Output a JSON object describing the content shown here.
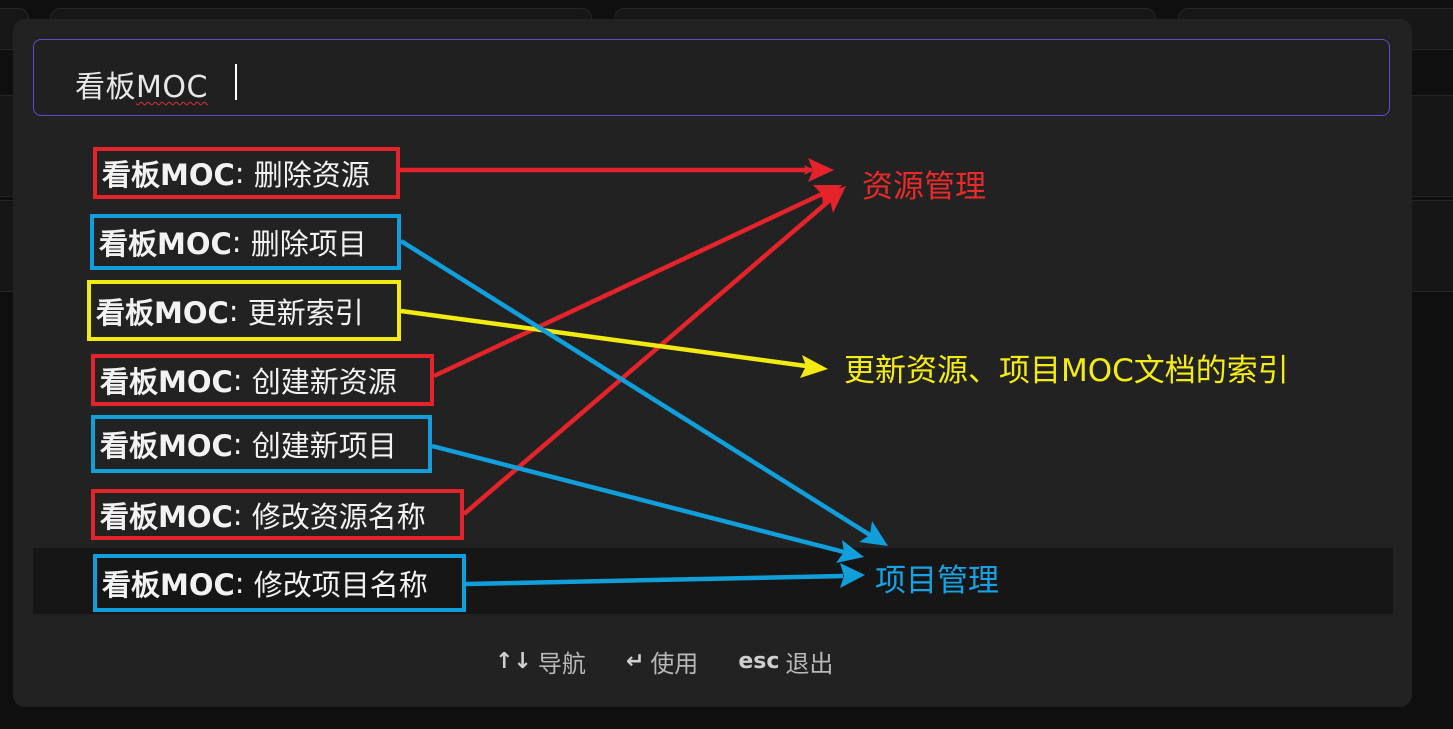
{
  "search": {
    "query_prefix": "看板",
    "query_suffix": "MOC"
  },
  "commands": [
    {
      "prefix": "看板MOC",
      "sep": ":",
      "action": "删除资源",
      "group": "资源管理"
    },
    {
      "prefix": "看板MOC",
      "sep": ":",
      "action": "删除项目",
      "group": "项目管理"
    },
    {
      "prefix": "看板MOC",
      "sep": ":",
      "action": "更新索引",
      "group": "更新资源、项目MOC文档的索引"
    },
    {
      "prefix": "看板MOC",
      "sep": ":",
      "action": "创建新资源",
      "group": "资源管理"
    },
    {
      "prefix": "看板MOC",
      "sep": ":",
      "action": "创建新项目",
      "group": "项目管理"
    },
    {
      "prefix": "看板MOC",
      "sep": ":",
      "action": "修改资源名称",
      "group": "资源管理"
    },
    {
      "prefix": "看板MOC",
      "sep": ":",
      "action": "修改项目名称",
      "group": "项目管理",
      "selected": true
    }
  ],
  "annotations": {
    "resource_mgmt": "资源管理",
    "index_update": "更新资源、项目MOC文档的索引",
    "project_mgmt": "项目管理"
  },
  "hints": {
    "navigate_keys": "↑↓",
    "navigate_label": "导航",
    "use_key": "↵",
    "use_label": "使用",
    "esc_key": "esc",
    "esc_label": "退出"
  },
  "colors": {
    "resource": "#e5232b",
    "project": "#119fdc",
    "index": "#f2ea10",
    "focus_border": "#5d4ec4"
  }
}
